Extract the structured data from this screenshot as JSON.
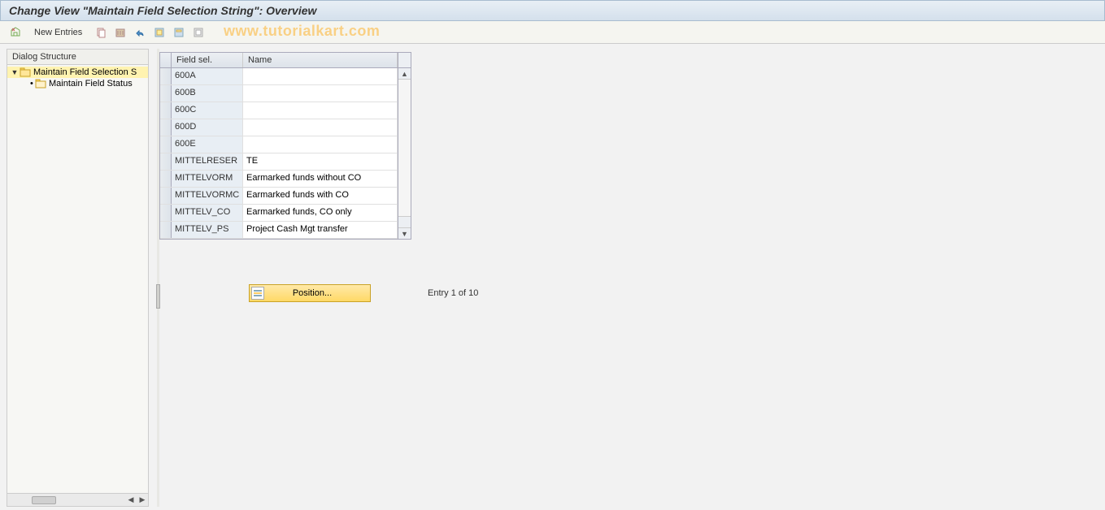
{
  "title": "Change View \"Maintain Field Selection String\": Overview",
  "toolbar": {
    "new_entries": "New Entries"
  },
  "watermark": "www.tutorialkart.com",
  "tree": {
    "header": "Dialog Structure",
    "node1": "Maintain Field Selection S",
    "node2": "Maintain Field Status"
  },
  "table": {
    "col_fieldsel": "Field sel.",
    "col_name": "Name",
    "rows": [
      {
        "field": "600A",
        "name": ""
      },
      {
        "field": "600B",
        "name": ""
      },
      {
        "field": "600C",
        "name": ""
      },
      {
        "field": "600D",
        "name": ""
      },
      {
        "field": "600E",
        "name": ""
      },
      {
        "field": "MITTELRESER",
        "name": "TE"
      },
      {
        "field": "MITTELVORM",
        "name": "Earmarked funds without CO"
      },
      {
        "field": "MITTELVORMC",
        "name": "Earmarked funds with CO"
      },
      {
        "field": "MITTELV_CO",
        "name": "Earmarked funds, CO only"
      },
      {
        "field": "MITTELV_PS",
        "name": "Project Cash Mgt transfer"
      }
    ]
  },
  "position_label": "Position...",
  "entry_text": "Entry 1 of 10"
}
